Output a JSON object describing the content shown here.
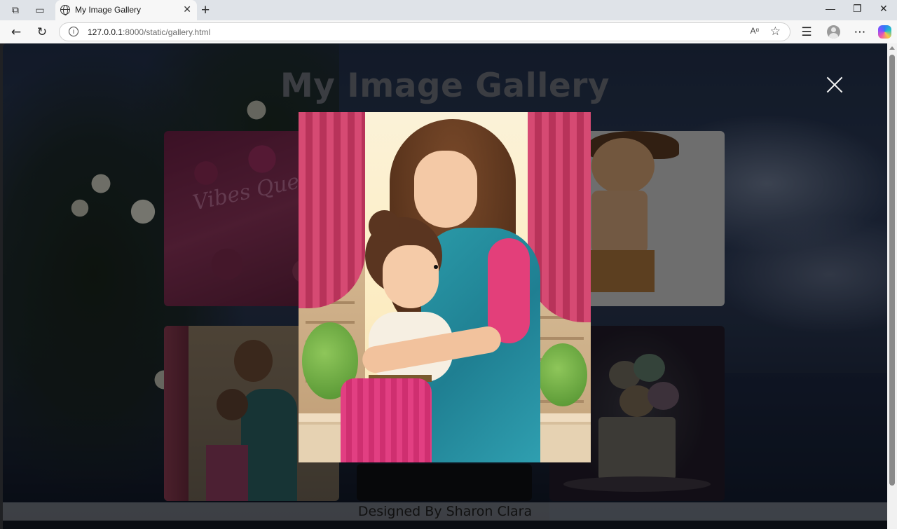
{
  "browser": {
    "tab": {
      "title": "My Image Gallery",
      "close": "✕",
      "favicon": "globe-icon"
    },
    "new_tab": "+",
    "window_controls": {
      "minimize": "—",
      "maximize": "❐",
      "close": "✕"
    },
    "address": {
      "host": "127.0.0.1",
      "rest": ":8000/static/gallery.html"
    },
    "read_aloud": "Aᵅ",
    "icons": [
      "workspaces-icon",
      "tab-actions-icon",
      "back-arrow-icon",
      "reload-icon",
      "info-icon",
      "read-aloud-icon",
      "favorite-star-icon",
      "favorites-icon",
      "profile-avatar-icon",
      "more-icon",
      "copilot-icon"
    ]
  },
  "page": {
    "title": "My Image Gallery",
    "footer": "Designed By Sharon Clara",
    "thumbnail_script": "Vibes Que"
  },
  "lightbox": {
    "close_icon": "close-icon"
  },
  "colors": {
    "overlay": "rgba(0,0,0,0.45)",
    "title": "#6c6f78",
    "close": "#f2f2f2",
    "curtain": "#d64a73",
    "saree": "#2a9aa8"
  }
}
